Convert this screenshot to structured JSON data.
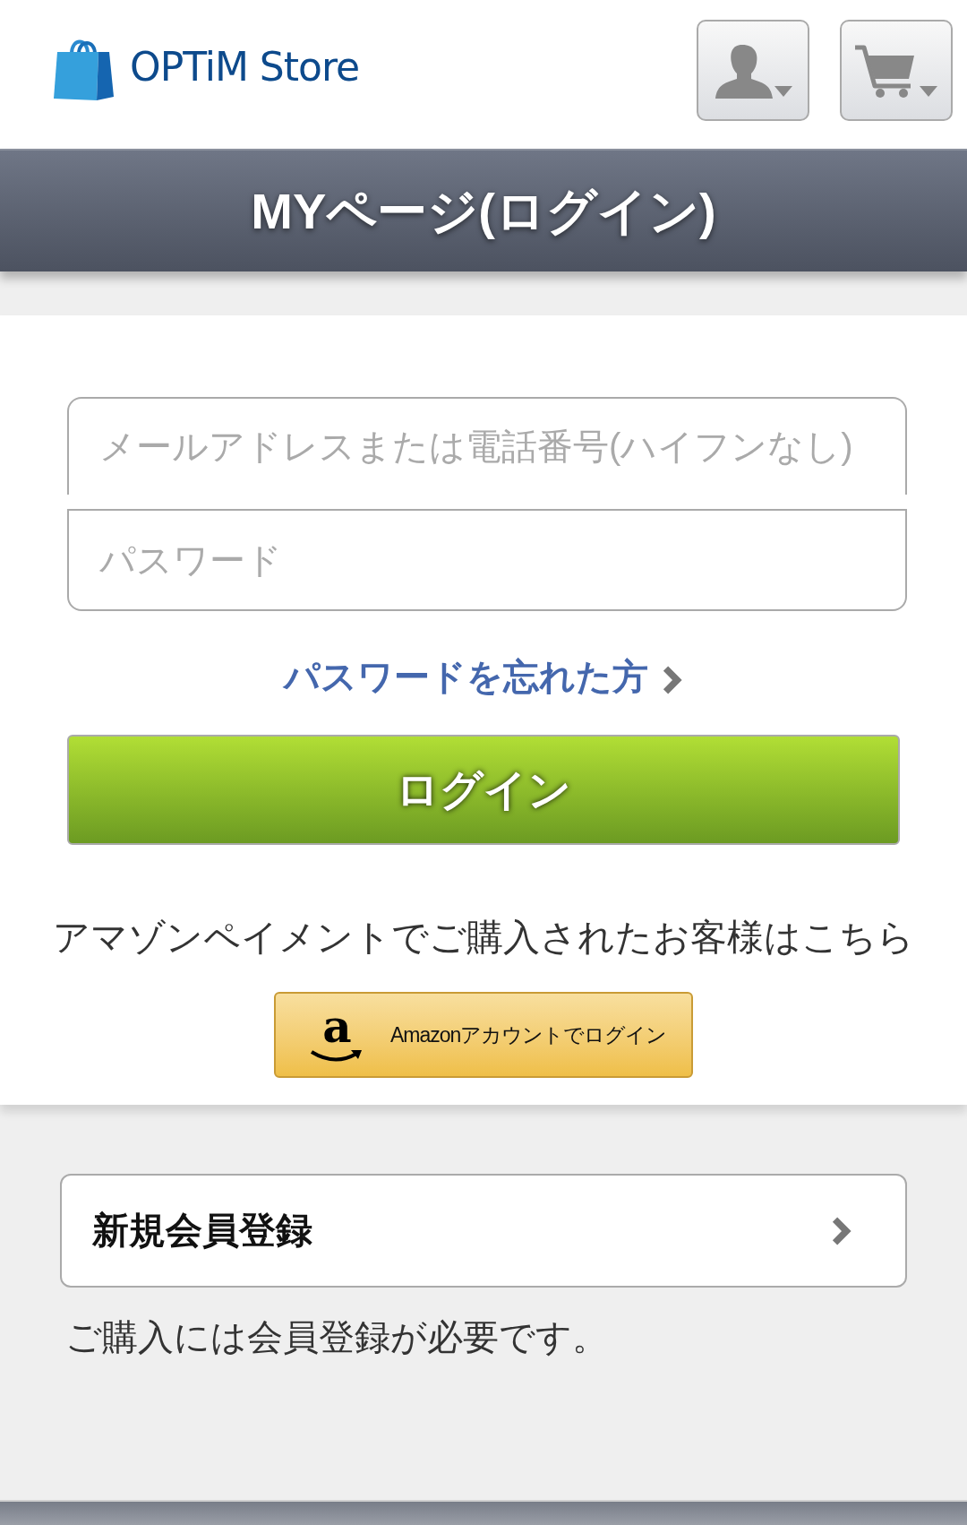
{
  "header": {
    "logo_text": "OPTiM Store"
  },
  "title": "MYページ(ログイン)",
  "login_form": {
    "email": {
      "placeholder": "メールアドレスまたは電話番号(ハイフンなし)"
    },
    "password": {
      "placeholder": "パスワード"
    },
    "forgot_link": "パスワードを忘れた方",
    "submit_button": "ログイン"
  },
  "amazon": {
    "note": "アマゾンペイメントでご購入されたお客様はこちら",
    "button": {
      "logo_letter": "a",
      "label": "Amazonアカウントでログイン"
    }
  },
  "register": {
    "link": "新規会員登録",
    "note": "ご購入には会員登録が必要です。"
  }
}
